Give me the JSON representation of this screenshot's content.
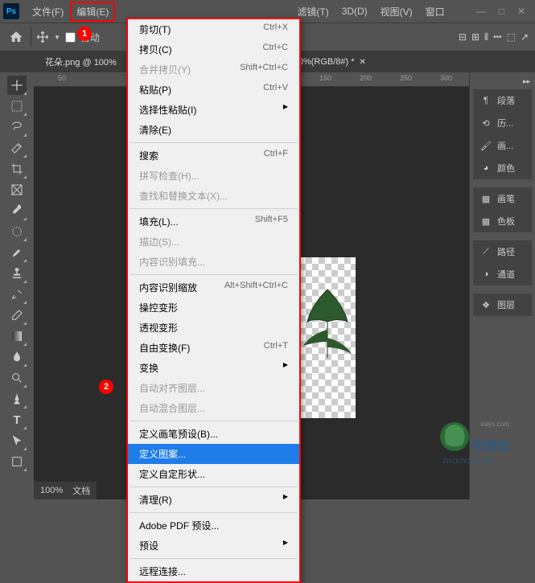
{
  "menubar": {
    "items": [
      "文件(F)",
      "编辑(E)",
      "滤镜(T)",
      "3D(D)",
      "视图(V)",
      "窗口"
    ]
  },
  "toolbar": {
    "auto_label": "自动"
  },
  "tabs": {
    "left": "花朵.png @ 100%",
    "right": "0%(RGB/8#) *"
  },
  "ruler": [
    "50",
    "150",
    "200",
    "250",
    "300"
  ],
  "dropdown": [
    {
      "label": "剪切(T)",
      "shortcut": "Ctrl+X"
    },
    {
      "label": "拷贝(C)",
      "shortcut": "Ctrl+C"
    },
    {
      "label": "合并拷贝(Y)",
      "shortcut": "Shift+Ctrl+C",
      "disabled": true
    },
    {
      "label": "粘贴(P)",
      "shortcut": "Ctrl+V"
    },
    {
      "label": "选择性粘贴(I)",
      "submenu": true
    },
    {
      "label": "清除(E)"
    },
    {
      "sep": true
    },
    {
      "label": "搜索",
      "shortcut": "Ctrl+F"
    },
    {
      "label": "拼写检查(H)...",
      "disabled": true
    },
    {
      "label": "查找和替换文本(X)...",
      "disabled": true
    },
    {
      "sep": true
    },
    {
      "label": "填充(L)...",
      "shortcut": "Shift+F5"
    },
    {
      "label": "描边(S)...",
      "disabled": true
    },
    {
      "label": "内容识别填充...",
      "disabled": true
    },
    {
      "sep": true
    },
    {
      "label": "内容识别缩放",
      "shortcut": "Alt+Shift+Ctrl+C"
    },
    {
      "label": "操控变形"
    },
    {
      "label": "透视变形"
    },
    {
      "label": "自由变换(F)",
      "shortcut": "Ctrl+T"
    },
    {
      "label": "变换",
      "submenu": true
    },
    {
      "label": "自动对齐图层...",
      "disabled": true
    },
    {
      "label": "自动混合图层...",
      "disabled": true
    },
    {
      "sep": true
    },
    {
      "label": "定义画笔预设(B)..."
    },
    {
      "label": "定义图案...",
      "highlighted": true
    },
    {
      "label": "定义自定形状..."
    },
    {
      "sep": true
    },
    {
      "label": "清理(R)",
      "submenu": true
    },
    {
      "sep": true
    },
    {
      "label": "Adobe PDF 预设..."
    },
    {
      "label": "预设",
      "submenu": true
    },
    {
      "sep": true
    },
    {
      "label": "远程连接..."
    }
  ],
  "panels": {
    "g1": [
      {
        "icon": "paragraph",
        "label": "段落"
      },
      {
        "icon": "history",
        "label": "历..."
      },
      {
        "icon": "brush",
        "label": "画..."
      },
      {
        "icon": "color",
        "label": "颜色"
      }
    ],
    "g2": [
      {
        "icon": "brush2",
        "label": "画笔"
      },
      {
        "icon": "swatch",
        "label": "色板"
      }
    ],
    "g3": [
      {
        "icon": "path",
        "label": "路径"
      },
      {
        "icon": "channel",
        "label": "通道"
      }
    ],
    "g4": [
      {
        "icon": "layer",
        "label": "图层"
      }
    ]
  },
  "status": {
    "zoom": "100%",
    "doc": "文档"
  },
  "callouts": {
    "c1": "1",
    "c2": "2"
  },
  "watermark": {
    "line1": "号游戏",
    "line2": "ZIYOUYOUXIWEI"
  }
}
